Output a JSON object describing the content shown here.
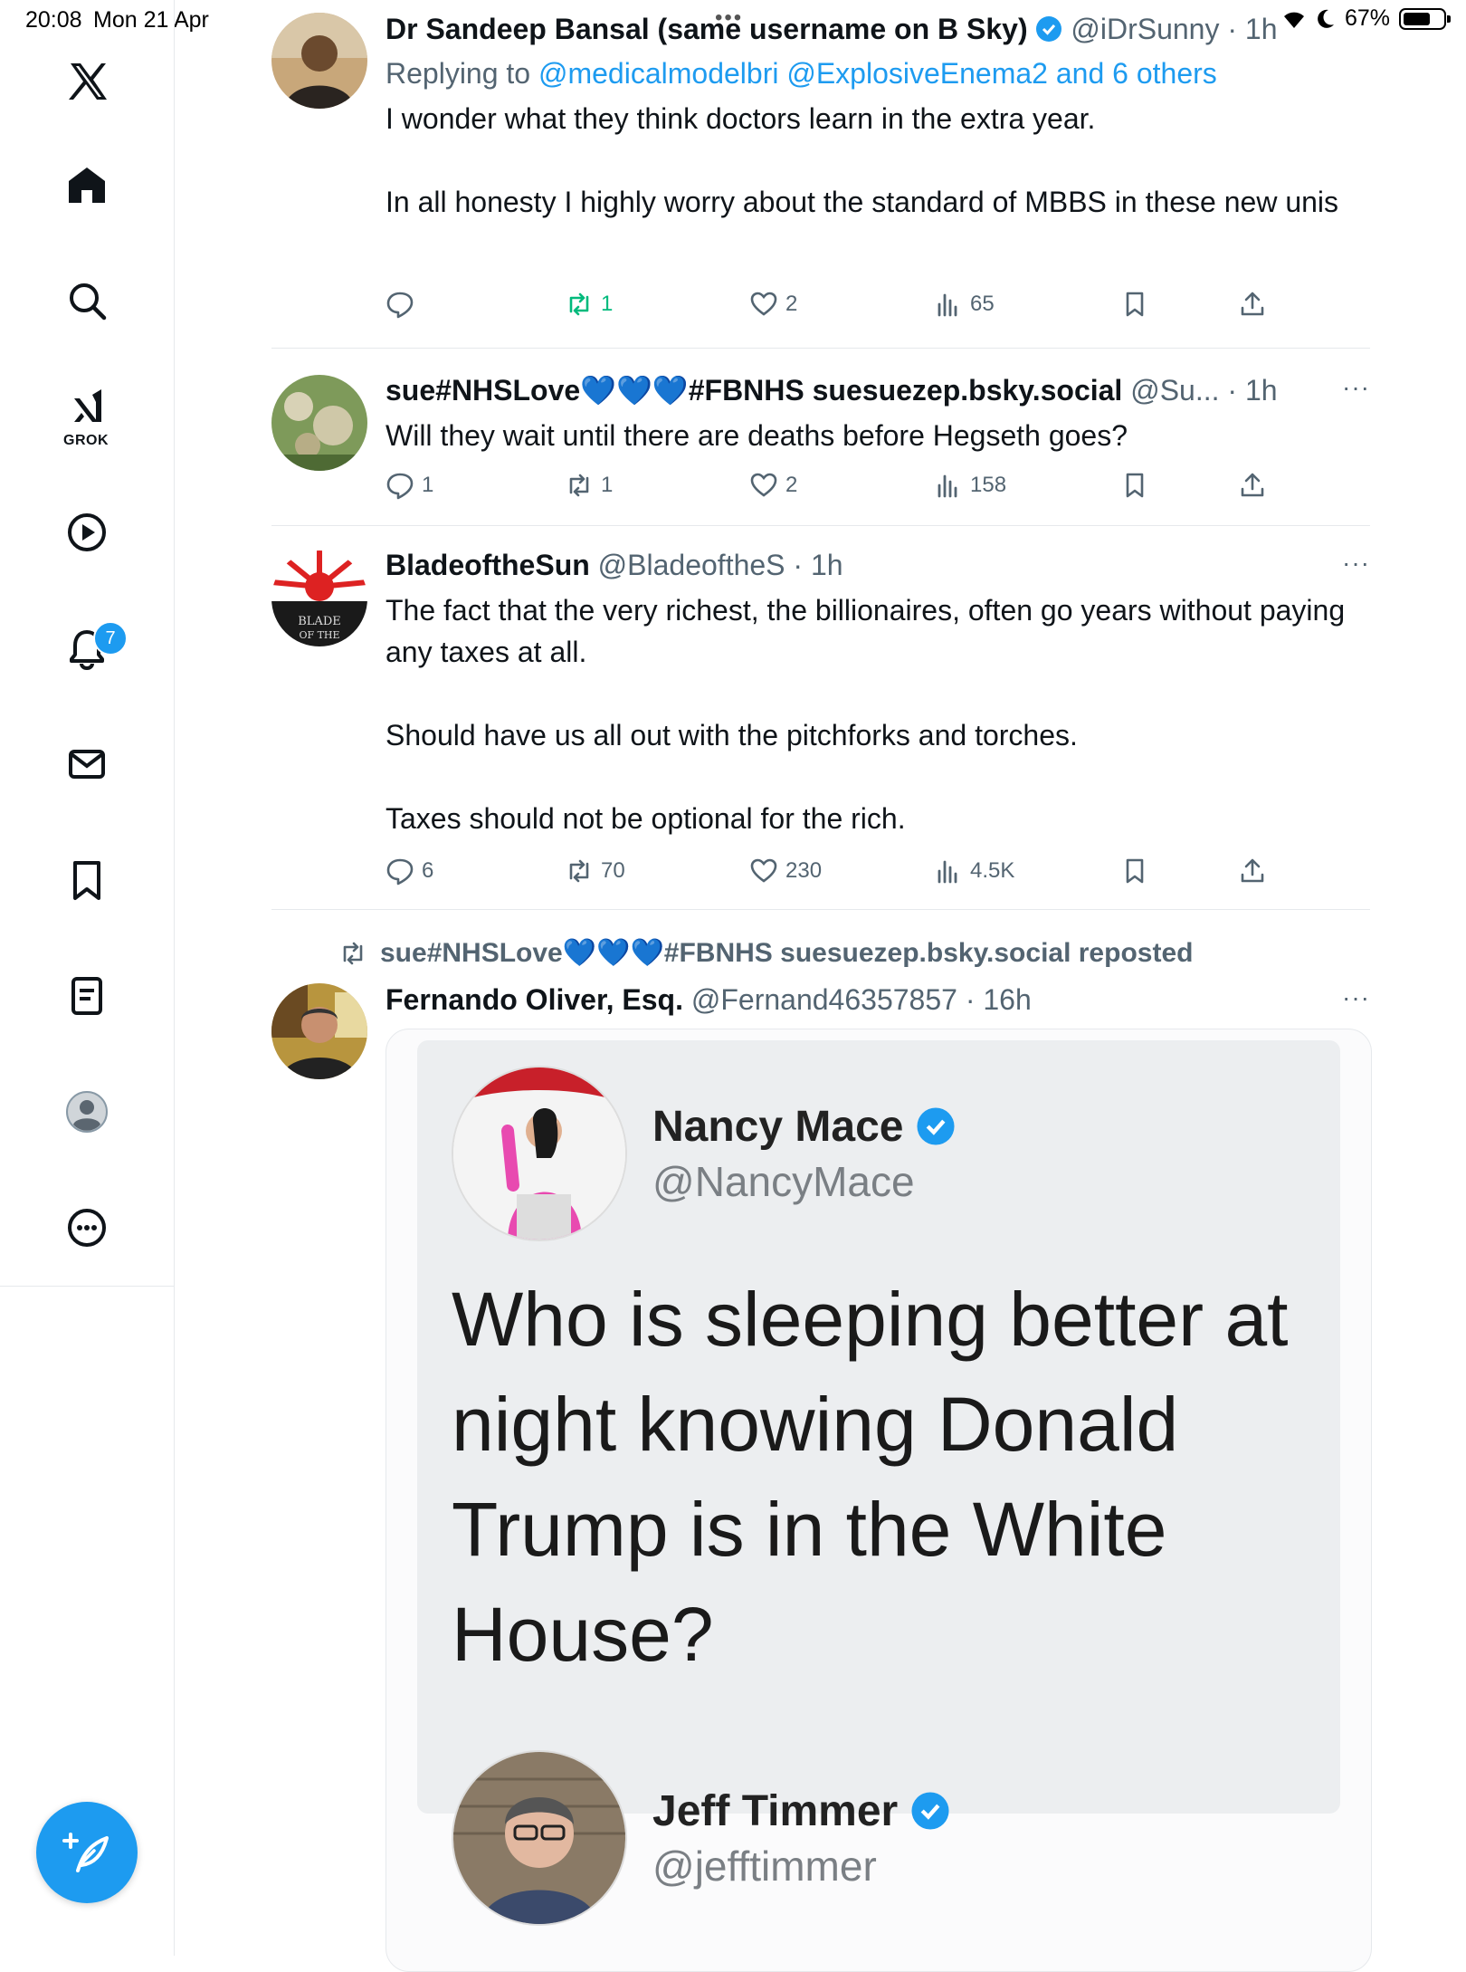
{
  "status_bar": {
    "time": "20:08",
    "date": "Mon 21 Apr",
    "battery": "67%",
    "battery_level": 0.67
  },
  "sidebar": {
    "notification_count": "7",
    "grok_label": "GROK"
  },
  "tweets": [
    {
      "name": "Dr Sandeep Bansal (same username on B Sky)",
      "handle": "@iDrSunny",
      "time": "· 1h",
      "replying_prefix": "Replying to",
      "replying_to": "@medicalmodelbri @ExplosiveEnema2 and 6 others",
      "text": "I wonder what they think doctors learn in the extra year.\n\nIn all honesty I highly worry about the standard of MBBS in these new unis",
      "replies": "",
      "reposts": "1",
      "likes": "2",
      "views": "65"
    },
    {
      "name": "sue#NHSLove💙💙💙#FBNHS suesuezep.bsky.social",
      "handle": "@Su...",
      "time": "· 1h",
      "more": "···",
      "text": "Will they wait until there are deaths before Hegseth goes?",
      "replies": "1",
      "reposts": "1",
      "likes": "2",
      "views": "158"
    },
    {
      "name": "BladeoftheSun",
      "handle": "@BladeoftheS",
      "time": "· 1h",
      "more": "···",
      "text": "The fact that the very richest, the billionaires, often go years without paying any taxes at all.\n\nShould have us all out with the pitchforks and torches.\n\nTaxes should not be optional for the rich.",
      "replies": "6",
      "reposts": "70",
      "likes": "230",
      "views": "4.5K"
    },
    {
      "reposted_by": "sue#NHSLove💙💙💙#FBNHS suesuezep.bsky.social reposted",
      "name": "Fernando Oliver, Esq.",
      "handle": "@Fernand46357857",
      "time": "· 16h",
      "more": "···"
    }
  ],
  "embedded": {
    "first": {
      "name": "Nancy Mace",
      "handle": "@NancyMace",
      "text": "Who is sleeping better at night knowing Donald Trump is in the White House?"
    },
    "second": {
      "name": "Jeff Timmer",
      "handle": "@jefftimmer"
    }
  },
  "colors": {
    "accent": "#1d9bf0",
    "text": "#0f1419",
    "muted": "#536471",
    "repost_active": "#00ba7c",
    "border": "#e6e9ec"
  }
}
